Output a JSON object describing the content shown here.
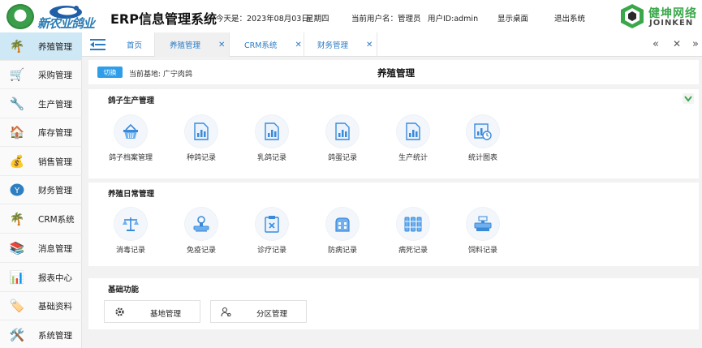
{
  "header": {
    "title": "ERP信息管理系统",
    "logo_text": "新农业鸽业",
    "date_label": "今天是：2023年08月03日",
    "weekday": "星期四",
    "user_label": "当前用户名：管理员",
    "user_id": "用户ID:admin",
    "show_desktop": "显示桌面",
    "logout": "退出系统",
    "brand_cn": "健坤网络",
    "brand_en": "JOINKEN"
  },
  "sidebar": {
    "items": [
      {
        "label": "养殖管理",
        "icon": "palm-tree-icon",
        "active": true
      },
      {
        "label": "采购管理",
        "icon": "cart-icon"
      },
      {
        "label": "生产管理",
        "icon": "wrench-icon"
      },
      {
        "label": "库存管理",
        "icon": "house-icon"
      },
      {
        "label": "销售管理",
        "icon": "coins-icon"
      },
      {
        "label": "财务管理",
        "icon": "yen-icon"
      },
      {
        "label": "CRM系统",
        "icon": "palm-tree-icon"
      },
      {
        "label": "消息管理",
        "icon": "books-icon"
      },
      {
        "label": "报表中心",
        "icon": "bar-chart-icon"
      },
      {
        "label": "基础资料",
        "icon": "tag-icon"
      },
      {
        "label": "系统管理",
        "icon": "tools-icon"
      }
    ]
  },
  "tabs": [
    {
      "label": "首页",
      "closable": false
    },
    {
      "label": "养殖管理",
      "closable": true,
      "active": true
    },
    {
      "label": "CRM系统",
      "closable": true
    },
    {
      "label": "财务管理",
      "closable": true
    }
  ],
  "tab_controls": {
    "prev": "«",
    "close": "✕",
    "next": "»"
  },
  "topbar": {
    "switch_label": "切换",
    "base_label": "当前基地: 广宁肉鸽",
    "page_title": "养殖管理"
  },
  "sections": {
    "pigeon_production": {
      "title": "鸽子生产管理",
      "items": [
        {
          "label": "鸽子档案管理",
          "icon": "basket-icon"
        },
        {
          "label": "种鸽记录",
          "icon": "report-chart-icon"
        },
        {
          "label": "乳鸽记录",
          "icon": "report-chart-icon"
        },
        {
          "label": "鸽蛋记录",
          "icon": "report-chart-icon"
        },
        {
          "label": "生产统计",
          "icon": "report-chart-icon"
        },
        {
          "label": "统计图表",
          "icon": "chart-clock-icon"
        }
      ]
    },
    "daily_management": {
      "title": "养殖日常管理",
      "items": [
        {
          "label": "消毒记录",
          "icon": "scale-icon"
        },
        {
          "label": "免疫记录",
          "icon": "stamp-icon"
        },
        {
          "label": "诊疗记录",
          "icon": "clipboard-icon"
        },
        {
          "label": "防病记录",
          "icon": "building-icon"
        },
        {
          "label": "病死记录",
          "icon": "binders-icon"
        },
        {
          "label": "饲料记录",
          "icon": "scale-machine-icon"
        }
      ]
    },
    "basic_functions": {
      "title": "基础功能",
      "buttons": [
        {
          "label": "基地管理",
          "icon": "gear-icon"
        },
        {
          "label": "分区管理",
          "icon": "user-settings-icon"
        }
      ]
    }
  },
  "colors": {
    "accent": "#2e9ee8",
    "sidebar_active": "#cfe8f6",
    "tab_text": "#2a7cc7",
    "brand_green": "#3aa84a"
  }
}
